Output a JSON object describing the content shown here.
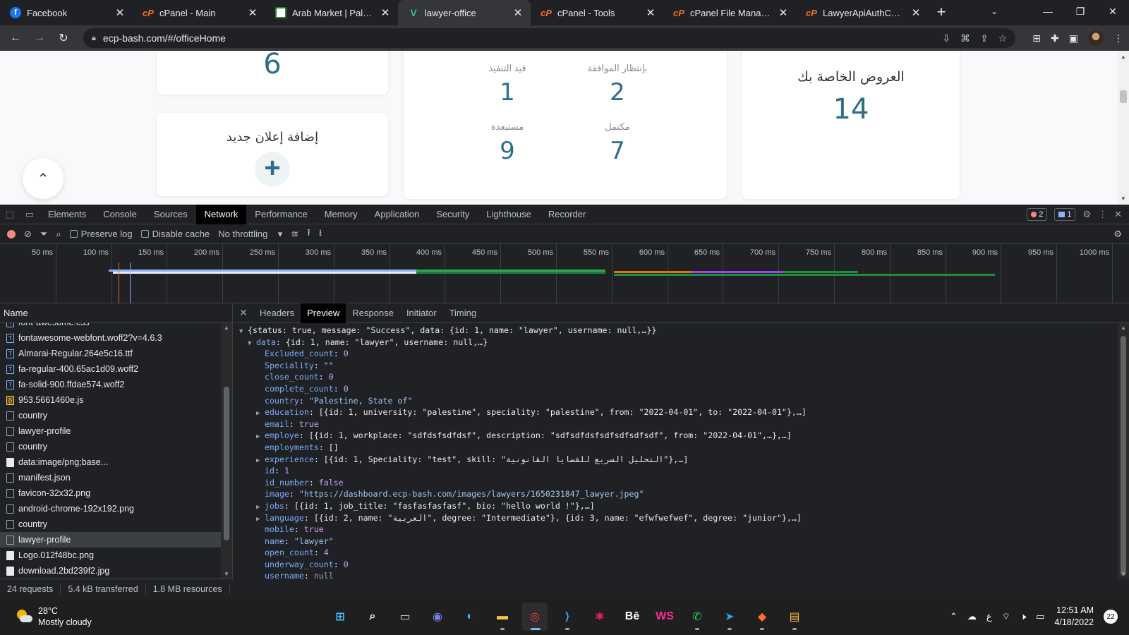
{
  "tabs": [
    {
      "title": "Facebook",
      "favicon": "facebook-icon",
      "active": false
    },
    {
      "title": "cPanel - Main",
      "favicon": "cpanel-icon",
      "active": false
    },
    {
      "title": "Arab Market | Palestin",
      "favicon": "arab-market-icon",
      "active": false
    },
    {
      "title": "lawyer-office",
      "favicon": "vue-icon",
      "active": true
    },
    {
      "title": "cPanel - Tools",
      "favicon": "cpanel-icon",
      "active": false
    },
    {
      "title": "cPanel File Manager v",
      "favicon": "cpanel-icon",
      "active": false
    },
    {
      "title": "LawyerApiAuthContro",
      "favicon": "cpanel-icon",
      "active": false
    }
  ],
  "address": {
    "url": "ecp-bash.com/#/officeHome"
  },
  "page": {
    "top_count": "6",
    "add_ad": {
      "title": "إضافة إعلان جديد",
      "plus": "+"
    },
    "stats": [
      {
        "label": "قيد التنفيذ",
        "value": "1"
      },
      {
        "label": "بإنتظار الموافقة",
        "value": "2"
      },
      {
        "label": "مستبعدة",
        "value": "9"
      },
      {
        "label": "مكتمل",
        "value": "7"
      }
    ],
    "offers": {
      "title": "العروض الخاصة بك",
      "value": "14"
    }
  },
  "devtools": {
    "tabs": [
      "Elements",
      "Console",
      "Sources",
      "Network",
      "Performance",
      "Memory",
      "Application",
      "Security",
      "Lighthouse",
      "Recorder"
    ],
    "active_tab": "Network",
    "errors_count": "2",
    "messages_count": "1",
    "network": {
      "preserve_log": "Preserve log",
      "disable_cache": "Disable cache",
      "throttling": "No throttling",
      "timeline_ticks": [
        "50 ms",
        "100 ms",
        "150 ms",
        "200 ms",
        "250 ms",
        "300 ms",
        "350 ms",
        "400 ms",
        "450 ms",
        "500 ms",
        "550 ms",
        "600 ms",
        "650 ms",
        "700 ms",
        "750 ms",
        "800 ms",
        "850 ms",
        "900 ms",
        "950 ms",
        "1000 ms"
      ],
      "name_header": "Name",
      "requests": [
        {
          "name": "font-awesome.css",
          "type": "css"
        },
        {
          "name": "fontawesome-webfont.woff2?v=4.6.3",
          "type": "font"
        },
        {
          "name": "Almarai-Regular.264e5c16.ttf",
          "type": "font"
        },
        {
          "name": "fa-regular-400.65ac1d09.woff2",
          "type": "font"
        },
        {
          "name": "fa-solid-900.ffdae574.woff2",
          "type": "font"
        },
        {
          "name": "953.5661460e.js",
          "type": "js"
        },
        {
          "name": "country",
          "type": "doc"
        },
        {
          "name": "lawyer-profile",
          "type": "doc"
        },
        {
          "name": "country",
          "type": "doc"
        },
        {
          "name": "data:image/png;base...",
          "type": "img"
        },
        {
          "name": "manifest.json",
          "type": "doc"
        },
        {
          "name": "favicon-32x32.png",
          "type": "doc"
        },
        {
          "name": "android-chrome-192x192.png",
          "type": "doc"
        },
        {
          "name": "country",
          "type": "doc"
        },
        {
          "name": "lawyer-profile",
          "type": "doc",
          "selected": true
        },
        {
          "name": "Logo.012f48bc.png",
          "type": "img"
        },
        {
          "name": "download.2bd239f2.jpg",
          "type": "img"
        }
      ],
      "detail_tabs": [
        "Headers",
        "Preview",
        "Response",
        "Initiator",
        "Timing"
      ],
      "active_detail_tab": "Preview",
      "status": {
        "requests": "24 requests",
        "transferred": "5.4 kB transferred",
        "resources": "1.8 MB resources"
      }
    },
    "preview_lines": [
      {
        "indent": 0,
        "tri": "▼",
        "text": "{status: true, message: \"Success\", data: {id: 1, name: \"lawyer\", username: null,…}}"
      },
      {
        "indent": 1,
        "tri": "▼",
        "key": "data",
        "value": "{id: 1, name: \"lawyer\", username: null,…}",
        "vclass": ""
      },
      {
        "indent": 2,
        "key": "Excluded_count",
        "value": "0",
        "vclass": "n"
      },
      {
        "indent": 2,
        "key": "Speciality",
        "value": "\"\"",
        "vclass": "str"
      },
      {
        "indent": 2,
        "key": "close_count",
        "value": "0",
        "vclass": "n"
      },
      {
        "indent": 2,
        "key": "complete_count",
        "value": "0",
        "vclass": "n"
      },
      {
        "indent": 2,
        "key": "country",
        "value": "\"Palestine, State of\"",
        "vclass": "str"
      },
      {
        "indent": 2,
        "tri": "▶",
        "key": "education",
        "value": "[{id: 1, university: \"palestine\", speciality: \"palestine\", from: \"2022-04-01\", to: \"2022-04-01\"},…]",
        "vclass": ""
      },
      {
        "indent": 2,
        "key": "email",
        "value": "true",
        "vclass": "b"
      },
      {
        "indent": 2,
        "tri": "▶",
        "key": "employe",
        "value": "[{id: 1, workplace: \"sdfdsfsdfdsf\", description: \"sdfsdfdsfsdfsdfsdfsdf\", from: \"2022-04-01\",…},…]",
        "vclass": ""
      },
      {
        "indent": 2,
        "key": "employments",
        "value": "[]",
        "vclass": ""
      },
      {
        "indent": 2,
        "tri": "▶",
        "key": "experience",
        "value": "[{id: 1, Speciality: \"test\", skill: \"التحليل السريع للقضايا القانونية\"},…]",
        "vclass": ""
      },
      {
        "indent": 2,
        "key": "id",
        "value": "1",
        "vclass": "n"
      },
      {
        "indent": 2,
        "key": "id_number",
        "value": "false",
        "vclass": "b"
      },
      {
        "indent": 2,
        "key": "image",
        "value": "\"https://dashboard.ecp-bash.com/images/lawyers/1650231847_lawyer.jpeg\"",
        "vclass": "str"
      },
      {
        "indent": 2,
        "tri": "▶",
        "key": "jobs",
        "value": "[{id: 1, job_title: \"fasfasfasfasf\", bio: \"hello world !\"},…]",
        "vclass": ""
      },
      {
        "indent": 2,
        "tri": "▶",
        "key": "language",
        "value": "[{id: 2, name: \"العربية\", degree: \"Intermediate\"}, {id: 3, name: \"efwfwefwef\", degree: \"junior\"},…]",
        "vclass": ""
      },
      {
        "indent": 2,
        "key": "mobile",
        "value": "true",
        "vclass": "b"
      },
      {
        "indent": 2,
        "key": "name",
        "value": "\"lawyer\"",
        "vclass": "str"
      },
      {
        "indent": 2,
        "key": "open_count",
        "value": "4",
        "vclass": "n"
      },
      {
        "indent": 2,
        "key": "underway_count",
        "value": "0",
        "vclass": "n"
      },
      {
        "indent": 2,
        "key": "username",
        "value": "null",
        "vclass": "null"
      },
      {
        "indent": 1,
        "key": "message",
        "value": "\"Success\"",
        "vclass": "str"
      }
    ]
  },
  "taskbar": {
    "weather_temp": "28°C",
    "weather_desc": "Mostly cloudy",
    "apps": [
      "windows-start-icon",
      "search-icon",
      "task-view-icon",
      "teams-chat-icon",
      "edge-icon",
      "file-explorer-icon",
      "chrome-icon",
      "vscode-icon",
      "slack-icon",
      "behance-icon",
      "webstorm-icon",
      "whatsapp-icon",
      "telegram-icon",
      "postman-icon",
      "files-icon"
    ],
    "time": "12:51 AM",
    "date": "4/18/2022",
    "notifications": "22",
    "ime": "ع"
  }
}
